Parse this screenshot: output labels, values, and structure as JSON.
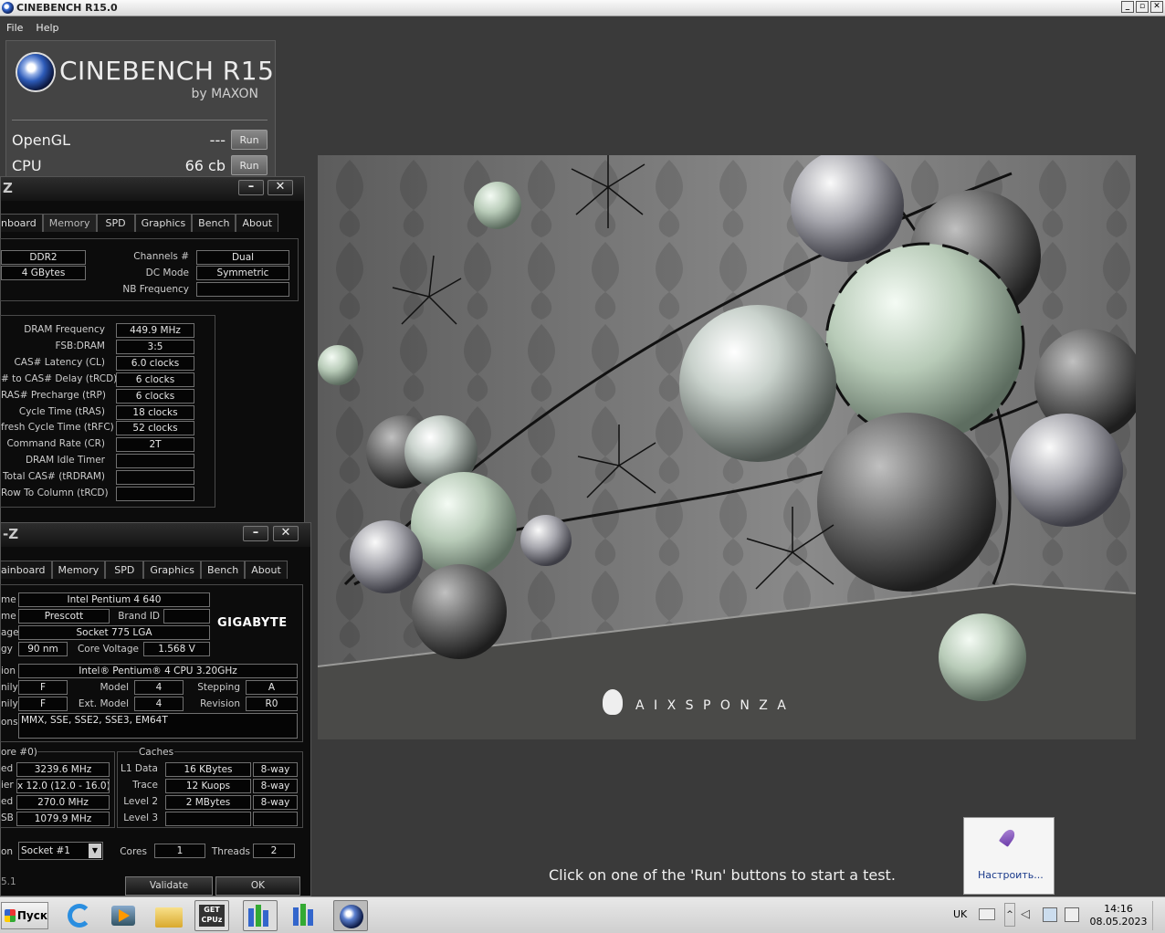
{
  "window": {
    "title": "CINEBENCH R15.0",
    "buttons": [
      "_",
      "▫",
      "✕"
    ]
  },
  "menu": [
    "File",
    "Help"
  ],
  "cinebench": {
    "brand": "CINEBENCH R15",
    "by": "by MAXON",
    "tests": [
      {
        "name": "OpenGL",
        "score": "---",
        "button": "Run"
      },
      {
        "name": "CPU",
        "score": "66 cb",
        "button": "Run"
      }
    ],
    "status": "Click on one of the 'Run' buttons to start a test.",
    "scene_brand": "A I X S P O N Z A"
  },
  "cpuz_memory": {
    "title_fragment": "Z",
    "tabs": [
      "nboard",
      "Memory",
      "SPD",
      "Graphics",
      "Bench",
      "About"
    ],
    "active_tab": "Memory",
    "general": {
      "type": "DDR2",
      "size": "4 GBytes",
      "channels_label": "Channels #",
      "channels": "Dual",
      "dc_mode_label": "DC Mode",
      "dc_mode": "Symmetric",
      "nb_freq_label": "NB Frequency",
      "nb_freq": ""
    },
    "timings": [
      {
        "label": "DRAM Frequency",
        "value": "449.9 MHz"
      },
      {
        "label": "FSB:DRAM",
        "value": "3:5"
      },
      {
        "label": "CAS# Latency (CL)",
        "value": "6.0 clocks"
      },
      {
        "label": "# to CAS# Delay (tRCD)",
        "value": "6 clocks"
      },
      {
        "label": "RAS# Precharge (tRP)",
        "value": "6 clocks"
      },
      {
        "label": "Cycle Time (tRAS)",
        "value": "18 clocks"
      },
      {
        "label": "fresh Cycle Time (tRFC)",
        "value": "52 clocks"
      },
      {
        "label": "Command Rate (CR)",
        "value": "2T"
      },
      {
        "label": "DRAM Idle Timer",
        "value": ""
      },
      {
        "label": "Total CAS# (tRDRAM)",
        "value": ""
      },
      {
        "label": "Row To Column (tRCD)",
        "value": ""
      }
    ]
  },
  "cpuz_cpu": {
    "title_fragment": "-Z",
    "tabs": [
      "ainboard",
      "Memory",
      "SPD",
      "Graphics",
      "Bench",
      "About"
    ],
    "name": "Intel Pentium 4 640",
    "codename": "Prescott",
    "brand_id_label": "Brand ID",
    "brand_id": "",
    "package": "Socket 775 LGA",
    "technology": "90 nm",
    "core_voltage_label": "Core Voltage",
    "core_voltage": "1.568 V",
    "logo": "GIGABYTE",
    "specification": "Intel® Pentium® 4 CPU 3.20GHz",
    "family": "F",
    "model_label": "Model",
    "model": "4",
    "stepping_label": "Stepping",
    "stepping": "A",
    "ext_family": "F",
    "ext_model_label": "Ext. Model",
    "ext_model": "4",
    "revision_label": "Revision",
    "revision": "R0",
    "instructions": "MMX, SSE, SSE2, SSE3, EM64T",
    "edge_labels": [
      "me",
      "me",
      "age",
      "gy",
      "ion",
      "nily",
      "nily",
      "ons"
    ],
    "clocks_title": "ore #0)",
    "clocks": [
      {
        "edge": "ed",
        "value": "3239.6 MHz"
      },
      {
        "edge": "ier",
        "value": "x 12.0 (12.0 - 16.0)"
      },
      {
        "edge": "ed",
        "value": "270.0 MHz"
      },
      {
        "edge": "SB",
        "value": "1079.9 MHz"
      }
    ],
    "caches_title": "Caches",
    "caches": [
      {
        "label": "L1 Data",
        "size": "16 KBytes",
        "way": "8-way"
      },
      {
        "label": "Trace",
        "size": "12 Kuops",
        "way": "8-way"
      },
      {
        "label": "Level 2",
        "size": "2 MBytes",
        "way": "8-way"
      },
      {
        "label": "Level 3",
        "size": "",
        "way": ""
      }
    ],
    "selection_edge": "on",
    "socket": "Socket #1",
    "cores_label": "Cores",
    "cores": "1",
    "threads_label": "Threads",
    "threads": "2",
    "version": "5.1",
    "validate": "Validate",
    "ok": "OK"
  },
  "notification": {
    "text": "Настроить..."
  },
  "taskbar": {
    "start": "Пуск",
    "lang": "UK",
    "time": "14:16",
    "date": "08.05.2023"
  }
}
